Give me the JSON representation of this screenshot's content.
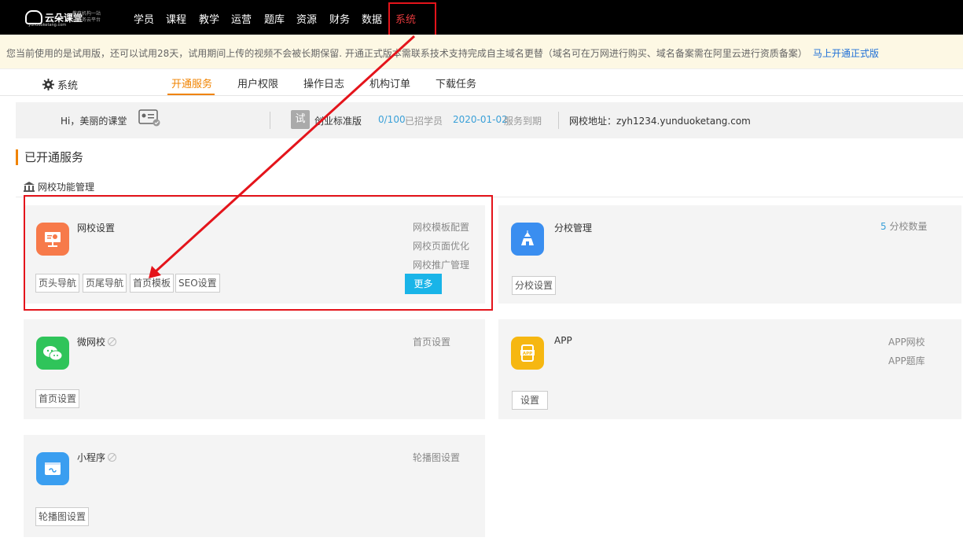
{
  "brand": {
    "name": "云朵课堂",
    "slogan_line1": "教育机构一站",
    "slogan_line2": "式服务云平台",
    "url": "yunduoketang.com"
  },
  "topnav": [
    "学员",
    "课程",
    "教学",
    "运营",
    "题库",
    "资源",
    "财务",
    "数据",
    "系统"
  ],
  "notice": {
    "text": "您当前使用的是试用版，还可以试用28天，试用期间上传的视频不会被长期保留. 开通正式版本需联系技术支持完成自主域名更替（域名可在万网进行购买、域名备案需在阿里云进行资质备案）",
    "link": "马上开通正式版"
  },
  "subnav": {
    "title": "系统",
    "tabs": [
      "开通服务",
      "用户权限",
      "操作日志",
      "机构订单",
      "下载任务"
    ]
  },
  "info": {
    "greeting": "Hi，美丽的课堂",
    "trial_badge": "试",
    "edition": "创业标准版",
    "students_count": "0/100",
    "students_label": "已招学员",
    "expiry_date": "2020-01-02",
    "expiry_label": "服务到期",
    "site_label": "网校地址：zyh1234.yunduoketang.com"
  },
  "section_title": "已开通服务",
  "sub_section": "网校功能管理",
  "cards": {
    "school_settings": {
      "title": "网校设置",
      "links": [
        "网校模板配置",
        "网校页面优化",
        "网校推广管理"
      ],
      "buttons": [
        "页头导航",
        "页尾导航",
        "首页模板",
        "SEO设置"
      ],
      "more": "更多",
      "icon_color": "#f77a4a"
    },
    "branch": {
      "title": "分校管理",
      "count": "5",
      "count_label": "分校数量",
      "button": "分校设置",
      "icon_color": "#3a8ef0"
    },
    "wechat": {
      "title": "微网校",
      "link": "首页设置",
      "button": "首页设置",
      "icon_color": "#2fc45a"
    },
    "app": {
      "title": "APP",
      "links": [
        "APP网校",
        "APP题库"
      ],
      "button": "设置",
      "icon_color": "#f6b711"
    },
    "miniprogram": {
      "title": "小程序",
      "link": "轮播图设置",
      "button": "轮播图设置",
      "icon_color": "#3a9ef0"
    }
  },
  "colors": {
    "accent": "#f08300",
    "highlight": "#e4141b",
    "primary_btn": "#19b4e8"
  }
}
